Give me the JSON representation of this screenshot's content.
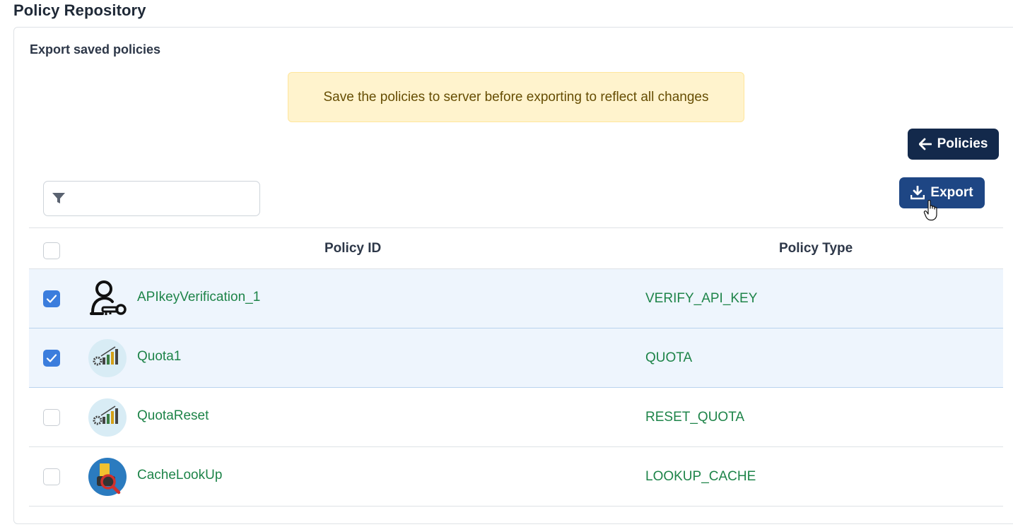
{
  "page": {
    "title": "Policy Repository"
  },
  "card": {
    "title": "Export saved policies"
  },
  "alert": {
    "text": "Save the policies to server before exporting to reflect all changes"
  },
  "buttons": {
    "policies": "Policies",
    "export": "Export"
  },
  "filter": {
    "value": "",
    "placeholder": ""
  },
  "table": {
    "columns": [
      "Policy ID",
      "Policy Type"
    ],
    "rows": [
      {
        "id": "APIkeyVerification_1",
        "type": "VERIFY_API_KEY",
        "checked": true,
        "icon": "api-key-user-icon"
      },
      {
        "id": "Quota1",
        "type": "QUOTA",
        "checked": true,
        "icon": "quota-chart-icon"
      },
      {
        "id": "QuotaReset",
        "type": "RESET_QUOTA",
        "checked": false,
        "icon": "quota-chart-icon"
      },
      {
        "id": "CacheLookUp",
        "type": "LOOKUP_CACHE",
        "checked": false,
        "icon": "cache-lookup-icon"
      }
    ]
  },
  "colors": {
    "primary_dark": "#13294b",
    "primary": "#1e4684",
    "link_green": "#1e8449",
    "selected_row": "#eef5fd",
    "checkbox_checked": "#3b7ddd",
    "alert_bg": "#fff3cd"
  }
}
